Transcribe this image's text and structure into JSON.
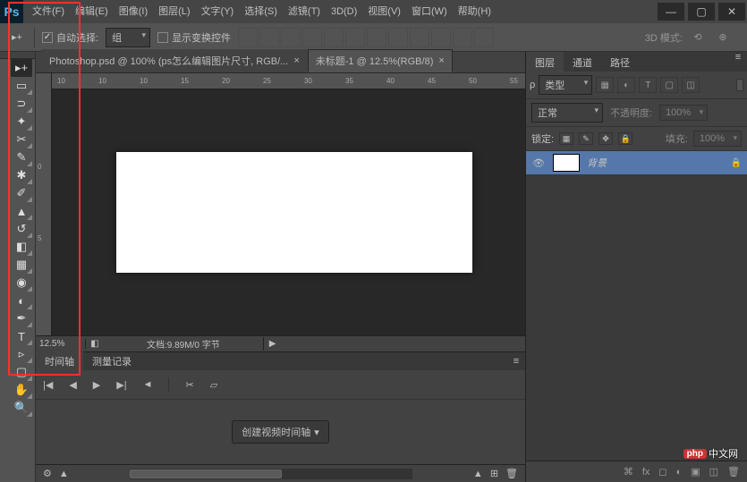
{
  "app": {
    "logo": "Ps"
  },
  "menu": {
    "file": "文件(F)",
    "edit": "编辑(E)",
    "image": "图像(I)",
    "layer": "图层(L)",
    "type": "文字(Y)",
    "select": "选择(S)",
    "filter": "滤镜(T)",
    "view3d": "3D(D)",
    "view": "视图(V)",
    "window": "窗口(W)",
    "help": "帮助(H)"
  },
  "options": {
    "auto_select": "自动选择:",
    "group_dropdown": "组",
    "show_transform": "显示变换控件",
    "mode3d_label": "3D 模式:"
  },
  "tabs": [
    {
      "label": "Photoshop.psd @ 100% (ps怎么编辑图片尺寸, RGB/...",
      "active": false
    },
    {
      "label": "未标题-1 @ 12.5%(RGB/8)",
      "active": true
    }
  ],
  "ruler_h": [
    "10",
    "10",
    "10",
    "15",
    "20",
    "25",
    "30",
    "35",
    "40",
    "45",
    "50",
    "55"
  ],
  "ruler_v": [
    "0",
    "5"
  ],
  "status": {
    "zoom": "12.5%",
    "doc_info": "文档:9.89M/0 字节",
    "arrow": "▶"
  },
  "timeline": {
    "tab_timeline": "时间轴",
    "tab_measure": "测量记录",
    "create_button": "创建视频时间轴"
  },
  "panels": {
    "tab_layers": "图层",
    "tab_channels": "通道",
    "tab_paths": "路径",
    "filter_kind": "类型",
    "blend_mode": "正常",
    "opacity_label": "不透明度:",
    "opacity_value": "100%",
    "lock_label": "锁定:",
    "fill_label": "填充:",
    "fill_value": "100%",
    "layer_background": "背景"
  },
  "watermark": {
    "badge": "php",
    "text": "中文网"
  }
}
